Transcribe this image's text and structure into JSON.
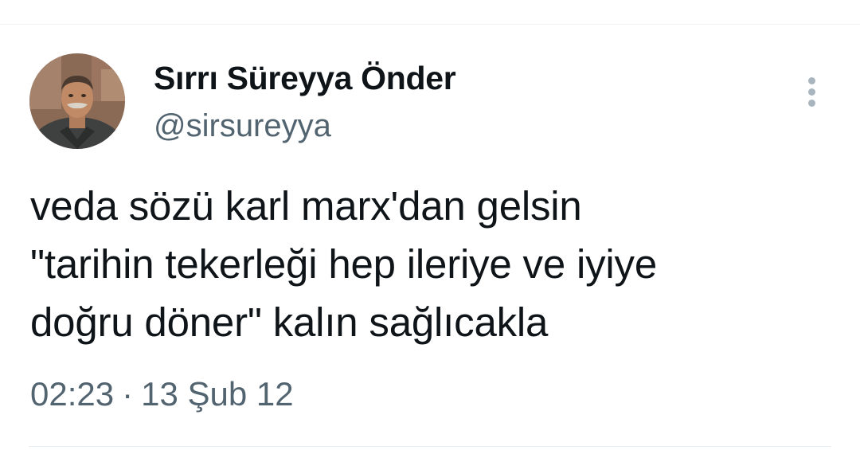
{
  "author": {
    "display_name": "Sırrı Süreyya Önder",
    "handle": "@sirsureyya"
  },
  "tweet": {
    "lines": [
      "veda sözü karl marx'dan gelsin",
      "\"tarihin tekerleği hep ileriye ve iyiye",
      "doğru döner\" kalın sağlıcakla"
    ],
    "time": "02:23",
    "separator": "·",
    "date": "13 Şub 12"
  },
  "icons": {
    "more": "more-vertical-icon"
  },
  "colors": {
    "text_primary": "#0f1419",
    "text_secondary": "#536471",
    "divider": "#eff3f4",
    "more_icon": "#a8b5bf"
  }
}
